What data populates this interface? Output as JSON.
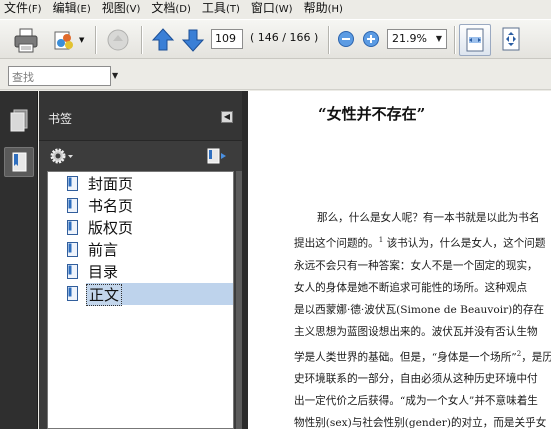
{
  "menu": [
    {
      "label": "文件",
      "key": "(F)"
    },
    {
      "label": "编辑",
      "key": "(E)"
    },
    {
      "label": "视图",
      "key": "(V)"
    },
    {
      "label": "文档",
      "key": "(D)"
    },
    {
      "label": "工具",
      "key": "(T)"
    },
    {
      "label": "窗口",
      "key": "(W)"
    },
    {
      "label": "帮助",
      "key": "(H)"
    }
  ],
  "toolbar": {
    "page_number": "109",
    "page_count": "( 146 / 166 )",
    "zoom": "21.9%"
  },
  "search": {
    "placeholder": "查找"
  },
  "bookmarks": {
    "title": "书签",
    "items": [
      {
        "label": "封面页"
      },
      {
        "label": "书名页"
      },
      {
        "label": "版权页"
      },
      {
        "label": "前言"
      },
      {
        "label": "目录"
      },
      {
        "label": "正文"
      }
    ]
  },
  "document": {
    "title": "“女性并不存在”",
    "lines": [
      "那么，什么是女人呢？有一本书就是以此为书名",
      "提出这个问题的。",
      "永远不会只有一种答案：女人不是一个固定的现实，",
      "女人的身体是她不断追求可能性的场所。这种观点",
      "是以西蒙娜·德·波伏瓦(Simone de Beauvoir)的存在",
      "主义思想为蓝图设想出来的。波伏瓦并没有否认生物",
      "学是人类世界的基础。但是，“身体是一个场所”",
      "史环境联系的一部分，自由必须从这种历史环境中付",
      "出一定代价之后获得。“成为一个女人”并不意味着生",
      "物性别(sex)与社会性别(gender)的对立，而是关乎女"
    ],
    "line2_sup": "1",
    "line2_rest": " 该书认为，什么是女人，这个问题",
    "line7_sup": "2",
    "line7_rest": "，是历"
  },
  "colors": {
    "panel_dark": "#3c3c3c",
    "selection": "#bed3ec",
    "accent_blue": "#2a6fc9"
  }
}
